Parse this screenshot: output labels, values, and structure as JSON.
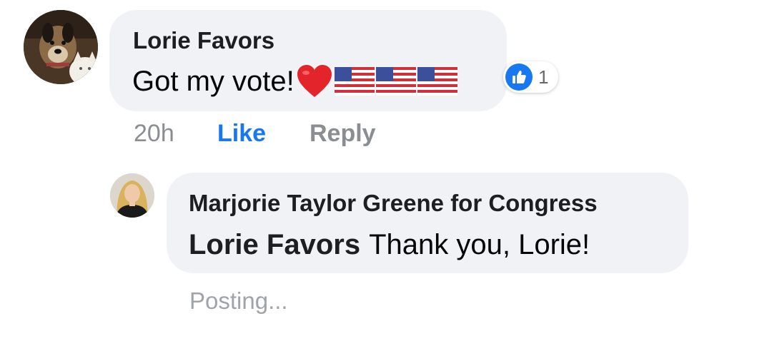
{
  "comment": {
    "author": "Lorie Favors",
    "text": "Got my vote!",
    "emojis": [
      "heart",
      "us-flag",
      "us-flag",
      "us-flag"
    ],
    "timestamp": "20h",
    "like_label": "Like",
    "reply_label": "Reply",
    "reaction_count": "1"
  },
  "reply": {
    "author": "Marjorie Taylor Greene for Congress",
    "mention": "Lorie Favors",
    "text": "Thank you, Lorie!",
    "status": "Posting..."
  },
  "colors": {
    "bubble": "#f0f2f5",
    "like_blue": "#1877f2",
    "meta_gray": "#8a8d91"
  }
}
